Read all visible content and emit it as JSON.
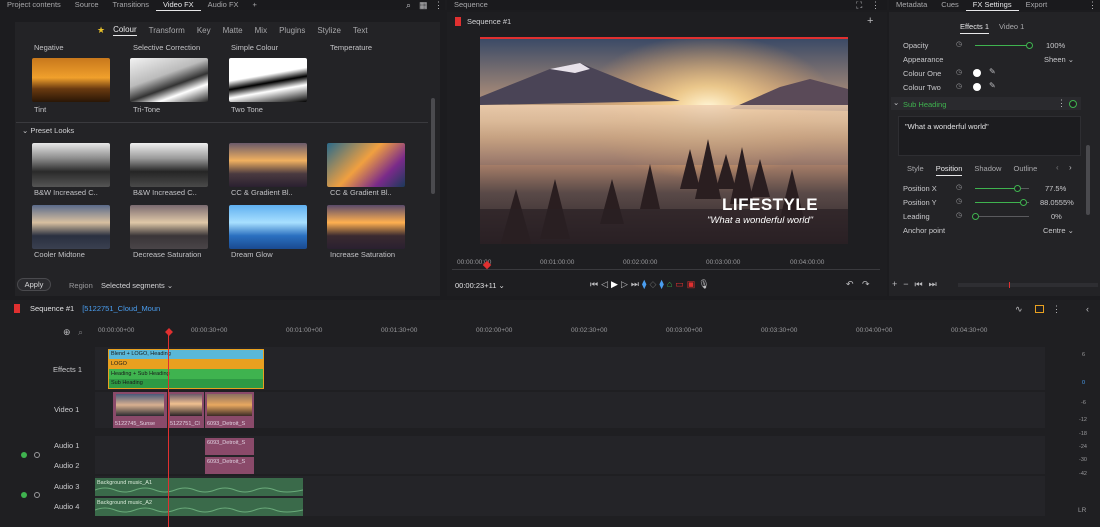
{
  "top_tabs_left": [
    "Project contents",
    "Source",
    "Transitions",
    "Video FX",
    "Audio FX",
    "+"
  ],
  "top_tabs_left_active": "Video FX",
  "top_tabs_middle": [
    "Sequence"
  ],
  "top_tabs_right": [
    "Metadata",
    "Cues",
    "FX Settings",
    "Export"
  ],
  "top_tabs_right_active": "FX Settings",
  "fx_browser": {
    "subtabs": [
      "Colour",
      "Transform",
      "Key",
      "Matte",
      "Mix",
      "Plugins",
      "Stylize",
      "Text"
    ],
    "active_subtab": "Colour",
    "headers": [
      "Negative",
      "Selective Correction",
      "Simple Colour",
      "Temperature"
    ],
    "row1": [
      "Tint",
      "Tri-Tone",
      "Two Tone"
    ],
    "preset_section": "Preset Looks",
    "presets_row1": [
      "B&W Increased C..",
      "B&W Increased C..",
      "CC & Gradient Bl..",
      "CC & Gradient Bl.."
    ],
    "presets_row2": [
      "Cooler Midtone",
      "Decrease Saturation",
      "Dream Glow",
      "Increase Saturation"
    ],
    "apply_label": "Apply",
    "region_label": "Region",
    "region_value": "Selected segments"
  },
  "viewer": {
    "sequence_name": "Sequence #1",
    "title_text": "LIFESTYLE",
    "subtitle_text": "\"What a wonderful world\"",
    "ruler": [
      "00:00:00:00",
      "00:01:00:00",
      "00:02:00:00",
      "00:03:00:00",
      "00:04:00:00"
    ],
    "timecode": "00:00:23+11"
  },
  "fx_settings": {
    "tabs": [
      "Effects 1",
      "Video 1"
    ],
    "opacity_label": "Opacity",
    "opacity_value": "100%",
    "opacity_level": 1.0,
    "appearance_label": "Appearance",
    "appearance_value": "Sheen",
    "colour_one_label": "Colour One",
    "colour_two_label": "Colour Two",
    "sub_heading_label": "Sub Heading",
    "text_value": "\"What a wonderful world\"",
    "style_tabs": [
      "Style",
      "Position",
      "Shadow",
      "Outline"
    ],
    "active_style_tab": "Position",
    "position_x_label": "Position X",
    "position_x_value": "77.5%",
    "position_x_level": 0.775,
    "position_y_label": "Position Y",
    "position_y_value": "88.0555%",
    "position_y_level": 0.88,
    "leading_label": "Leading",
    "leading_value": "0%",
    "leading_level": 0.0,
    "anchor_label": "Anchor point",
    "anchor_value": "Centre",
    "accent": "#3fb34f"
  },
  "timeline": {
    "sequence_name": "Sequence #1",
    "clip_name": "[5122751_Cloud_Moun",
    "ruler": [
      "00:00:00+00",
      "00:00:30+00",
      "00:01:00+00",
      "00:01:30+00",
      "00:02:00+00",
      "00:02:30+00",
      "00:03:00+00",
      "00:03:30+00",
      "00:04:00+00",
      "00:04:30+00"
    ],
    "tracks": [
      "Effects 1",
      "Video 1",
      "Audio 1",
      "Audio 2",
      "Audio 3",
      "Audio 4"
    ],
    "effect_rows": [
      "Blend + LOGO, Heading",
      "LOGO",
      "Heading + Sub Heading",
      "Sub Heading"
    ],
    "video_clips": [
      "5122745_Sunse",
      "5122751_Cl",
      "6093_Detroit_S"
    ],
    "audio12_clips": [
      "6093_Detroit_S",
      "6093_Detroit_S"
    ],
    "audio34_clips": [
      "Background music_A1",
      "Background music_A2"
    ],
    "meter_labels": [
      "6",
      "0",
      "-6",
      "-12",
      "-18",
      "-24",
      "-30",
      "-42"
    ],
    "meter_footer": "LR"
  }
}
